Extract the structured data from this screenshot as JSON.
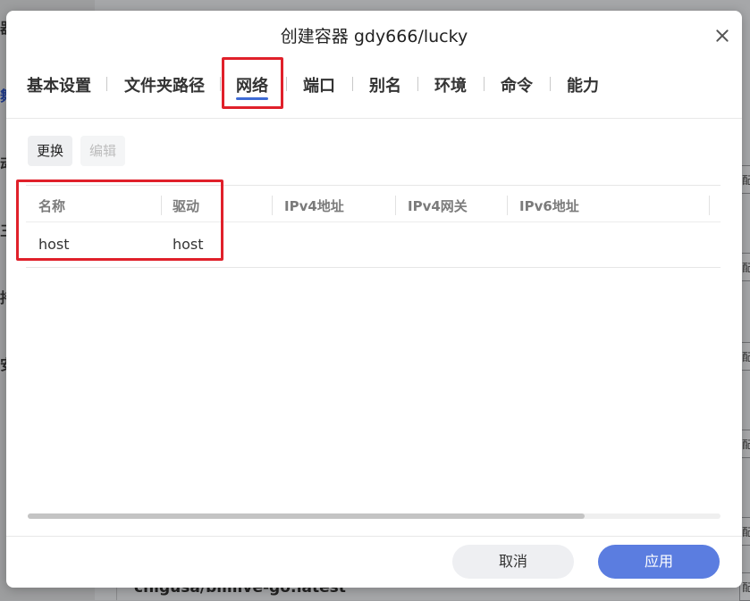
{
  "background": {
    "sidebar_glyphs": [
      "器",
      "舞",
      "动",
      "三",
      "持",
      "安"
    ],
    "right_cells": [
      "配",
      "配",
      "配",
      "配",
      "配",
      "配"
    ],
    "bottom_text": "chigusa/bililive-go:latest"
  },
  "dialog": {
    "title": "创建容器 gdy666/lucky",
    "tabs": [
      {
        "label": "基本设置"
      },
      {
        "label": "文件夹路径"
      },
      {
        "label": "网络",
        "active": true
      },
      {
        "label": "端口"
      },
      {
        "label": "别名"
      },
      {
        "label": "环境"
      },
      {
        "label": "命令"
      },
      {
        "label": "能力"
      }
    ],
    "toolbar": {
      "replace_label": "更换",
      "edit_label": "编辑"
    },
    "table": {
      "columns": [
        "名称",
        "驱动",
        "IPv4地址",
        "IPv4网关",
        "IPv6地址"
      ],
      "rows": [
        [
          "host",
          "host",
          "",
          "",
          ""
        ]
      ]
    },
    "footer": {
      "cancel_label": "取消",
      "apply_label": "应用"
    }
  },
  "colors": {
    "accent": "#5b7de0",
    "tab_underline": "#3e6bd6",
    "highlight_box": "#e0202a"
  }
}
